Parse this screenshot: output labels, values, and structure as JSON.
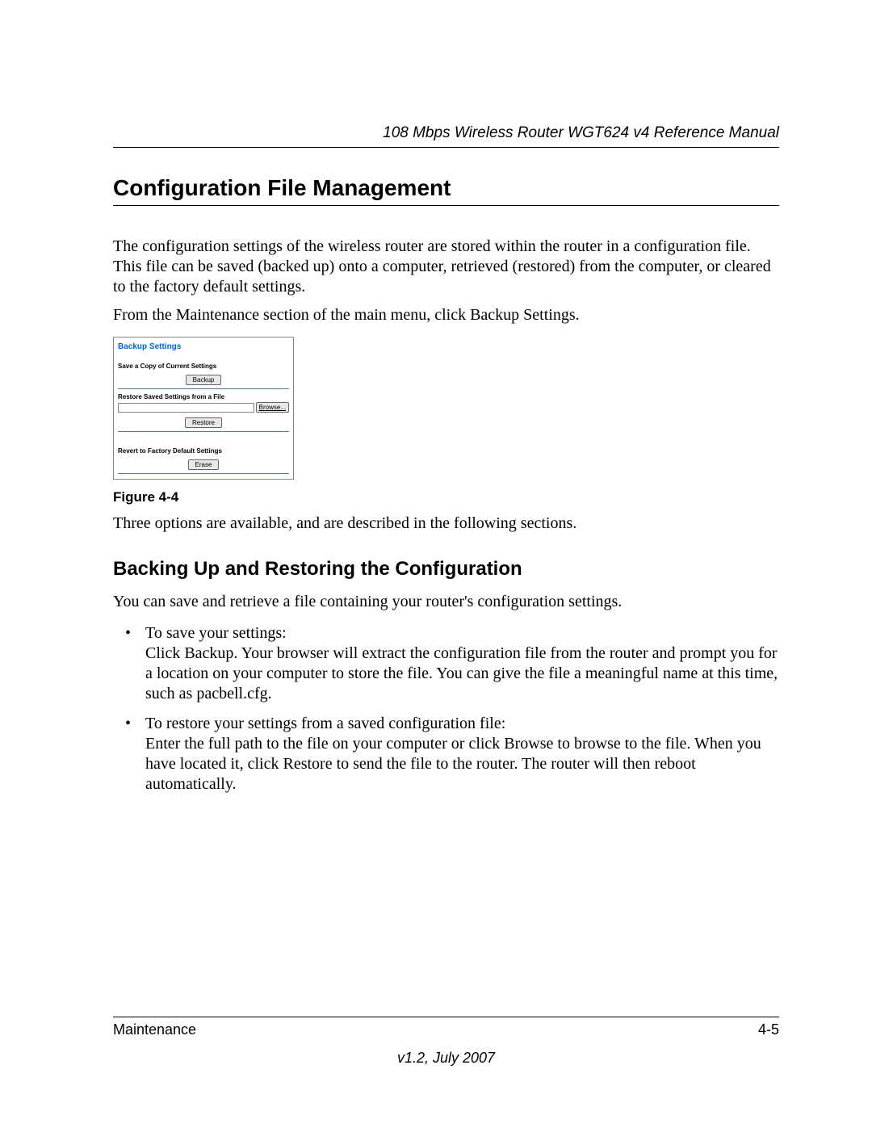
{
  "header": {
    "doc_title": "108 Mbps Wireless Router WGT624 v4 Reference Manual"
  },
  "h1": "Configuration File Management",
  "para1": "The configuration settings of the wireless router are stored within the router in a configuration file. This file can be saved (backed up) onto a computer, retrieved (restored) from the computer, or cleared to the factory default settings.",
  "para2": "From the Maintenance section of the main menu, click Backup Settings.",
  "screenshot": {
    "title": "Backup Settings",
    "save_label": "Save a Copy of Current Settings",
    "backup_btn": "Backup",
    "restore_label": "Restore Saved Settings from a File",
    "browse_btn": "Browse...",
    "restore_btn": "Restore",
    "revert_label": "Revert to Factory Default Settings",
    "erase_btn": "Erase"
  },
  "figure_caption": "Figure 4-4",
  "para3": "Three options are available, and are described in the following sections.",
  "h2": "Backing Up and Restoring the Configuration",
  "para4": "You can save and retrieve a file containing your router's configuration settings.",
  "bullets": [
    {
      "lead": "To save your settings:",
      "body": "Click Backup. Your browser will extract the configuration file from the router and prompt you for a location on your computer to store the file. You can give the file a meaningful name at this time, such as pacbell.cfg."
    },
    {
      "lead": "To restore your settings from a saved configuration file:",
      "body": "Enter the full path to the file on your computer or click Browse to browse to the file. When you have located it, click Restore to send the file to the router. The router will then reboot automatically."
    }
  ],
  "footer": {
    "section": "Maintenance",
    "page": "4-5",
    "version": "v1.2, July 2007"
  }
}
